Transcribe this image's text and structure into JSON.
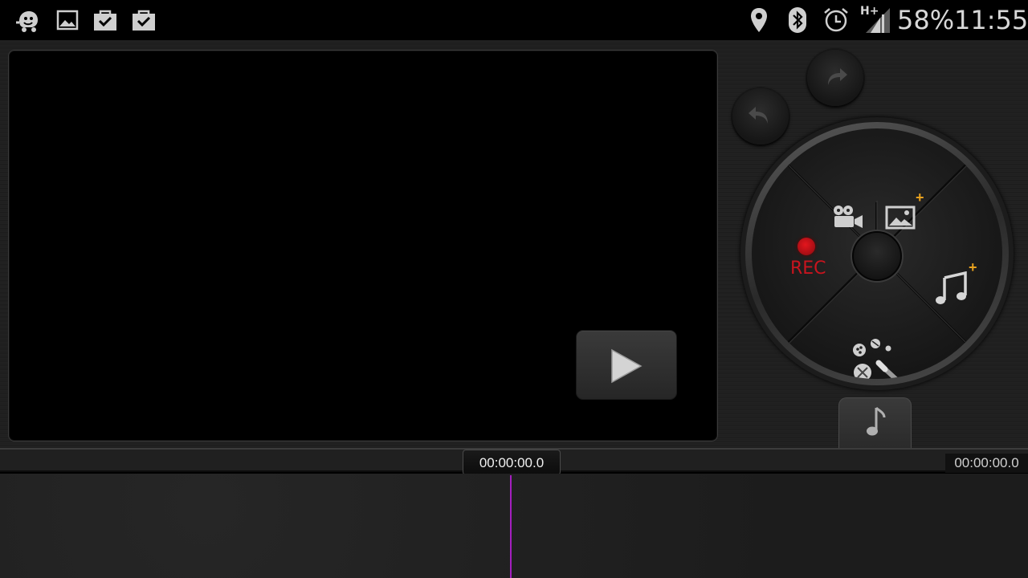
{
  "status_bar": {
    "battery": "58%",
    "time": "11:55",
    "network": "H+",
    "notification_icons": [
      "waze-icon",
      "gallery-icon",
      "shopping-bag-check-icon",
      "shopping-bag-check-icon"
    ],
    "system_icons": [
      "location-pin-icon",
      "bluetooth-icon",
      "alarm-clock-icon",
      "signal-icon"
    ]
  },
  "editor": {
    "play_icon": "play-icon",
    "undo_icon": "undo-icon",
    "redo_icon": "redo-icon",
    "dial": {
      "top": {
        "icons": [
          "video-camera-icon",
          "image-icon"
        ],
        "plus": "+"
      },
      "right": {
        "icon": "music-note-icon",
        "plus": "+"
      },
      "left": {
        "label": "REC",
        "icon": "record-dot-icon"
      },
      "bottom": {
        "icon": "effects-wand-icon"
      }
    },
    "audio_tab_icon": "music-note-icon"
  },
  "timeline": {
    "current_time": "00:00:00.0",
    "total_time": "00:00:00.0",
    "playhead_color": "#a41fbf"
  },
  "colors": {
    "rec_red": "#c8141e",
    "plus_orange": "#e8a11e"
  }
}
